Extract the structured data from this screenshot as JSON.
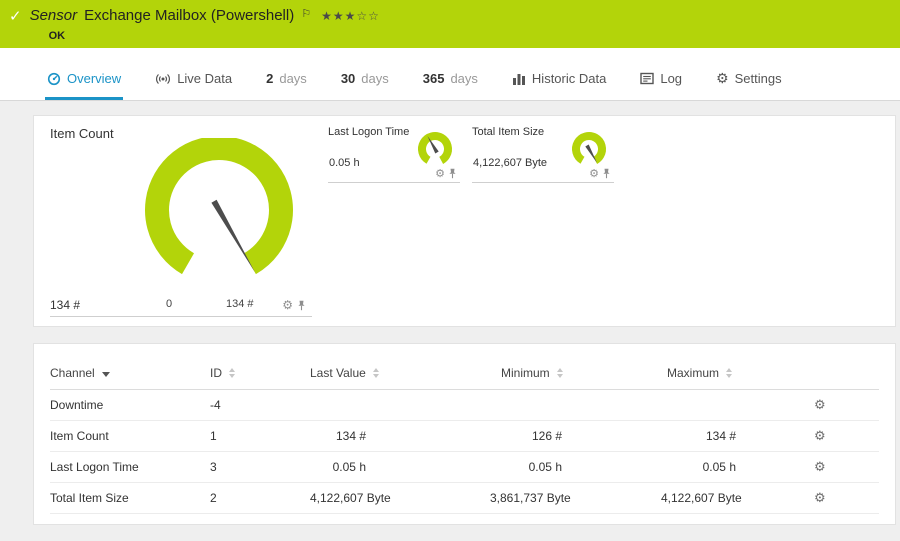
{
  "colors": {
    "banner": "#b3d40a",
    "gauge": "#b3d40a",
    "active_tab": "#1b93c7"
  },
  "banner": {
    "check_icon": "✓",
    "kind": "Sensor",
    "title": "Exchange Mailbox (Powershell)",
    "flag_icon": "⚐",
    "stars": "★★★☆☆",
    "status": "OK"
  },
  "tabs": {
    "overview": "Overview",
    "live_data": "Live Data",
    "days2_num": "2",
    "days30_num": "30",
    "days365_num": "365",
    "days_unit": "days",
    "historic": "Historic Data",
    "log": "Log",
    "settings": "Settings",
    "settings_gear_icon": "⚙"
  },
  "gauges": {
    "main": {
      "title": "Item Count",
      "min_label": "0",
      "max_label": "134 #",
      "current": "134 #"
    },
    "minis": [
      {
        "title": "Last Logon Time",
        "value": "0.05 h"
      },
      {
        "title": "Total Item Size",
        "value": "4,122,607 Byte"
      }
    ],
    "gear_icon": "⚙"
  },
  "table": {
    "columns": [
      "Channel",
      "ID",
      "Last Value",
      "Minimum",
      "Maximum"
    ],
    "rows": [
      {
        "channel": "Downtime",
        "id": "-4",
        "last": "",
        "min": "",
        "max": ""
      },
      {
        "channel": "Item Count",
        "id": "1",
        "last": "134 #",
        "min": "126 #",
        "max": "134 #"
      },
      {
        "channel": "Last Logon Time",
        "id": "3",
        "last": "0.05 h",
        "min": "0.05 h",
        "max": "0.05 h"
      },
      {
        "channel": "Total Item Size",
        "id": "2",
        "last": "4,122,607 Byte",
        "min": "3,861,737 Byte",
        "max": "4,122,607 Byte"
      }
    ],
    "row_gear_icon": "⚙"
  },
  "chart_data": [
    {
      "type": "gauge",
      "title": "Item Count",
      "min": 0,
      "max": 134,
      "value": 134,
      "unit": "#"
    },
    {
      "type": "gauge",
      "title": "Last Logon Time",
      "value": 0.05,
      "unit": "h"
    },
    {
      "type": "gauge",
      "title": "Total Item Size",
      "value": 4122607,
      "unit": "Byte"
    }
  ]
}
